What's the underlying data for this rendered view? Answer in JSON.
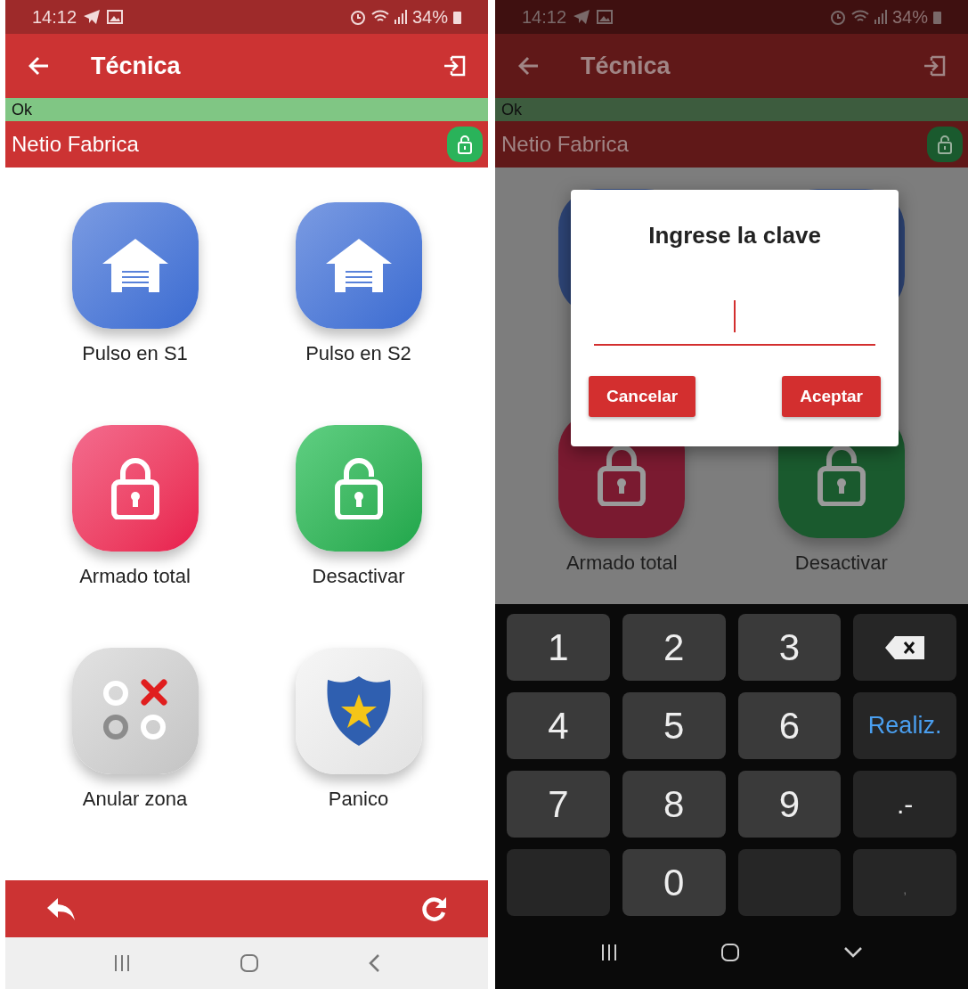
{
  "screens": [
    {
      "status_bar": {
        "time": "14:12",
        "battery": "34%"
      },
      "app_bar": {
        "title": "Técnica"
      },
      "status_message": "Ok",
      "device": {
        "name": "Netio Fabrica"
      },
      "actions": [
        {
          "label": "Pulso en S1",
          "kind": "gate"
        },
        {
          "label": "Pulso en S2",
          "kind": "gate"
        },
        {
          "label": "Armado total",
          "kind": "lock"
        },
        {
          "label": "Desactivar",
          "kind": "unlock"
        },
        {
          "label": "Anular zona",
          "kind": "zones"
        },
        {
          "label": "Panico",
          "kind": "panic"
        }
      ]
    },
    {
      "status_bar": {
        "time": "14:12",
        "battery": "34%"
      },
      "app_bar": {
        "title": "Técnica"
      },
      "status_message": "Ok",
      "device": {
        "name": "Netio Fabrica"
      },
      "actions": [
        {
          "label": "Armado total",
          "kind": "lock"
        },
        {
          "label": "Desactivar",
          "kind": "unlock"
        }
      ],
      "dialog": {
        "title": "Ingrese la clave",
        "buttons": [
          "Cancelar",
          "Aceptar"
        ]
      },
      "keyboard": [
        {
          "kind": "digit",
          "label": "1"
        },
        {
          "kind": "digit",
          "label": "2"
        },
        {
          "kind": "digit",
          "label": "3"
        },
        {
          "kind": "backspace"
        },
        {
          "kind": "digit",
          "label": "4"
        },
        {
          "kind": "digit",
          "label": "5"
        },
        {
          "kind": "digit",
          "label": "6"
        },
        {
          "kind": "done",
          "label": "Realiz."
        },
        {
          "kind": "digit",
          "label": "7"
        },
        {
          "kind": "digit",
          "label": "8"
        },
        {
          "kind": "digit",
          "label": "9"
        },
        {
          "kind": "symbol",
          "label": ".-"
        },
        {
          "kind": "blank"
        },
        {
          "kind": "digit",
          "label": "0"
        },
        {
          "kind": "blank"
        },
        {
          "kind": "faint",
          "label": ","
        }
      ]
    }
  ]
}
